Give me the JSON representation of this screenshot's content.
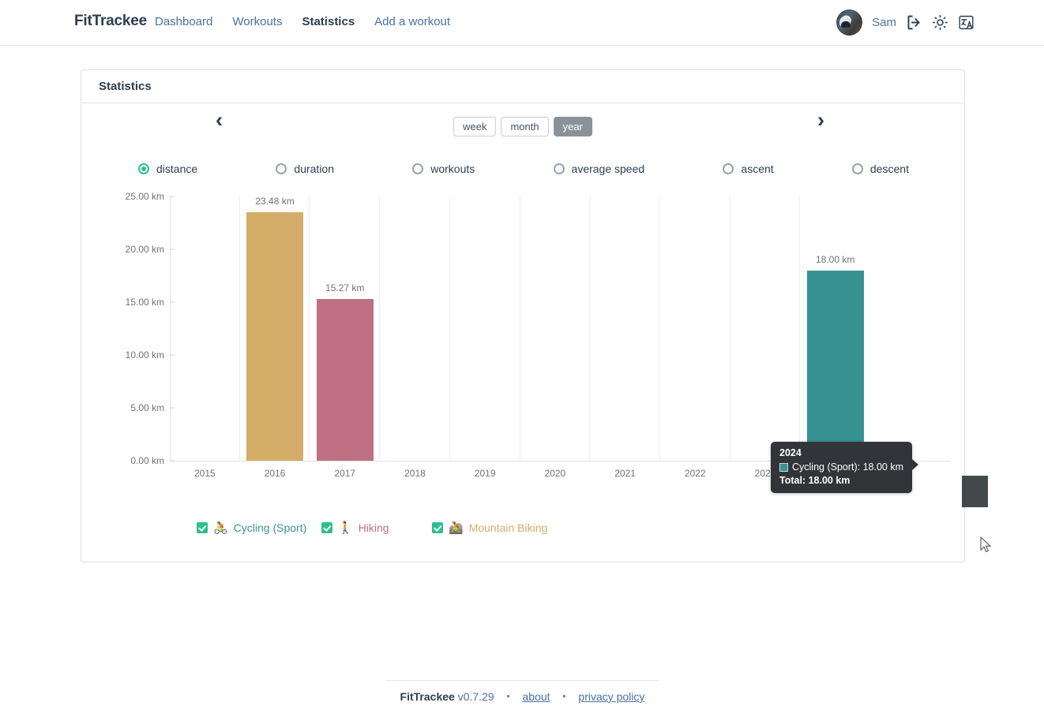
{
  "header": {
    "brand": "FitTrackee",
    "nav": [
      {
        "label": "Dashboard",
        "active": false
      },
      {
        "label": "Workouts",
        "active": false
      },
      {
        "label": "Statistics",
        "active": true
      },
      {
        "label": "Add a workout",
        "active": false
      }
    ],
    "username": "Sam",
    "icons": {
      "avatar": "avatar-photo",
      "logout": "logout-icon",
      "theme": "sun-icon",
      "language": "language-icon"
    }
  },
  "card": {
    "title": "Statistics"
  },
  "controls": {
    "prev": "‹",
    "next": "›",
    "periods": [
      {
        "label": "week",
        "selected": false
      },
      {
        "label": "month",
        "selected": false
      },
      {
        "label": "year",
        "selected": true
      }
    ]
  },
  "metrics": [
    {
      "label": "distance",
      "selected": true
    },
    {
      "label": "duration",
      "selected": false
    },
    {
      "label": "workouts",
      "selected": false
    },
    {
      "label": "average speed",
      "selected": false
    },
    {
      "label": "ascent",
      "selected": false
    },
    {
      "label": "descent",
      "selected": false
    }
  ],
  "tooltip": {
    "title": "2024",
    "entry_label": "Cycling (Sport): 18.00 km",
    "total": "Total: 18.00 km",
    "swatch_color": "#379392"
  },
  "legend": [
    {
      "label": "Cycling (Sport)",
      "color": "#379392",
      "icon": "bicycle-icon",
      "glyph": "🚴",
      "checked": true
    },
    {
      "label": "Hiking",
      "color": "#bf7082",
      "icon": "hiker-icon",
      "glyph": "🚶",
      "checked": true
    },
    {
      "label": "Mountain Biking",
      "color": "#d4ad68",
      "icon": "mountain-biking-icon",
      "glyph": "🚵",
      "checked": true
    }
  ],
  "footer": {
    "brand": "FitTrackee",
    "version": "v0.7.29",
    "dot": "•",
    "about": "about",
    "privacy": "privacy policy"
  },
  "chart_data": {
    "type": "bar",
    "title": "",
    "xlabel": "",
    "ylabel": "",
    "unit": "km",
    "categories": [
      "2015",
      "2016",
      "2017",
      "2018",
      "2019",
      "2020",
      "2021",
      "2022",
      "2023",
      "2024"
    ],
    "ylim": [
      0,
      25
    ],
    "yticks": [
      0,
      5,
      10,
      15,
      20,
      25
    ],
    "ytick_labels": [
      "0.00 km",
      "5.00 km",
      "10.00 km",
      "15.00 km",
      "20.00 km",
      "25.00 km"
    ],
    "grid": false,
    "legend_position": "bottom",
    "bars": [
      {
        "category": "2015",
        "value": 0,
        "label": "",
        "sport": "",
        "color": ""
      },
      {
        "category": "2016",
        "value": 23.48,
        "label": "23.48 km",
        "sport": "Mountain Biking",
        "color": "#d4ad68"
      },
      {
        "category": "2017",
        "value": 15.27,
        "label": "15.27 km",
        "sport": "Hiking",
        "color": "#bf7082"
      },
      {
        "category": "2018",
        "value": 0,
        "label": "",
        "sport": "",
        "color": ""
      },
      {
        "category": "2019",
        "value": 0,
        "label": "",
        "sport": "",
        "color": ""
      },
      {
        "category": "2020",
        "value": 0,
        "label": "",
        "sport": "",
        "color": ""
      },
      {
        "category": "2021",
        "value": 0,
        "label": "",
        "sport": "",
        "color": ""
      },
      {
        "category": "2022",
        "value": 0,
        "label": "",
        "sport": "",
        "color": ""
      },
      {
        "category": "2023",
        "value": 0,
        "label": "",
        "sport": "",
        "color": ""
      },
      {
        "category": "2024",
        "value": 18.0,
        "label": "18.00 km",
        "sport": "Cycling (Sport)",
        "color": "#379392"
      }
    ],
    "series": [
      {
        "name": "Cycling (Sport)",
        "color": "#379392",
        "values": [
          0,
          0,
          0,
          0,
          0,
          0,
          0,
          0,
          0,
          18.0
        ]
      },
      {
        "name": "Hiking",
        "color": "#bf7082",
        "values": [
          0,
          0,
          15.27,
          0,
          0,
          0,
          0,
          0,
          0,
          0
        ]
      },
      {
        "name": "Mountain Biking",
        "color": "#d4ad68",
        "values": [
          0,
          23.48,
          0,
          0,
          0,
          0,
          0,
          0,
          0,
          0
        ]
      }
    ]
  }
}
